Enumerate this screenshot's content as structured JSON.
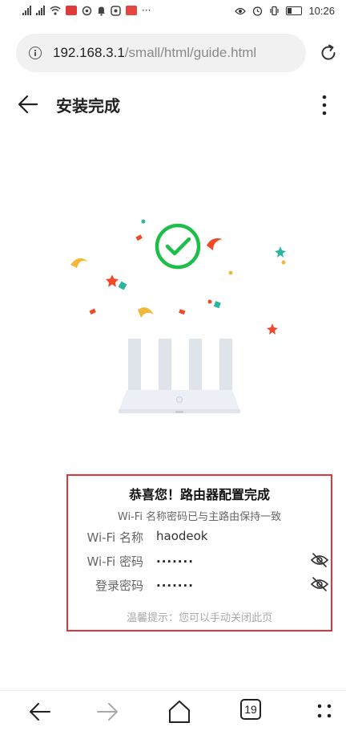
{
  "status_bar": {
    "time": "10:26",
    "left_icons": [
      "signal-icon",
      "signal-icon",
      "wifi-icon",
      "app-notification-icon",
      "app-notification-icon",
      "bell-icon",
      "app-notification-icon",
      "app-notification-icon",
      "more-notifications-icon"
    ],
    "right_icons": [
      "eye-comfort-icon",
      "alarm-icon",
      "vibrate-icon",
      "battery-icon"
    ],
    "overflow_dots": "···"
  },
  "browser": {
    "url_host": "192.168.3.1",
    "url_path": "/small/html/guide.html"
  },
  "header": {
    "title": "安装完成"
  },
  "card": {
    "title": "恭喜您！路由器配置完成",
    "subtitle": "Wi-Fi 名称密码已与主路由保持一致",
    "wifi_name_label": "Wi-Fi 名称",
    "wifi_name_value": "haodeok",
    "wifi_password_label": "Wi-Fi 密码",
    "wifi_password_value": ".......",
    "login_password_label": "登录密码",
    "login_password_value": ".......",
    "hint": "温馨提示：您可以手动关闭此页"
  },
  "bottom_nav": {
    "tab_count": "19"
  },
  "colors": {
    "accent_green": "#1dbf4a",
    "highlight_red": "#e0353b",
    "url_bg": "#f1f1f1"
  }
}
